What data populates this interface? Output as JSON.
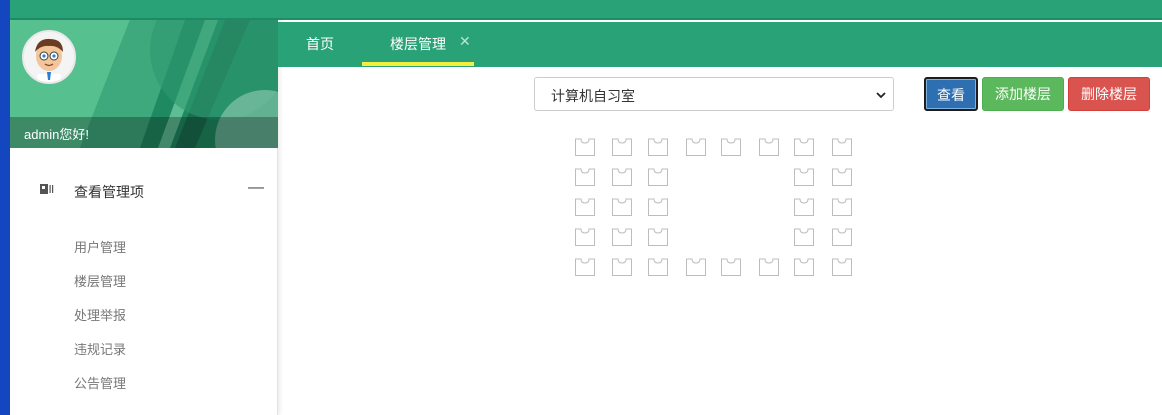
{
  "sidebar": {
    "welcome": "admin您好!",
    "group": {
      "label": "查看管理项",
      "icon": "id-card-icon",
      "collapse": "—"
    },
    "items": [
      {
        "label": "用户管理"
      },
      {
        "label": "楼层管理"
      },
      {
        "label": "处理举报"
      },
      {
        "label": "违规记录"
      },
      {
        "label": "公告管理"
      }
    ]
  },
  "tabs": [
    {
      "label": "首页",
      "active": false
    },
    {
      "label": "楼层管理",
      "active": true,
      "close": "✕"
    }
  ],
  "toolbar": {
    "room_select_value": "计算机自习室",
    "view_label": "查看",
    "add_label": "添加楼层",
    "delete_label": "删除楼层"
  },
  "seat_grid": {
    "icon": "seat-icon",
    "rows": [
      [
        1,
        1,
        1,
        1,
        1,
        1,
        1,
        1
      ],
      [
        1,
        1,
        1,
        0,
        0,
        0,
        1,
        1
      ],
      [
        1,
        1,
        1,
        0,
        0,
        0,
        1,
        1
      ],
      [
        1,
        1,
        1,
        0,
        0,
        0,
        1,
        1
      ],
      [
        1,
        1,
        1,
        1,
        1,
        1,
        1,
        1
      ]
    ]
  },
  "colors": {
    "brand_green": "#2aa278",
    "tab_active_underline": "#f4ee3f",
    "view_button": "#2d6fb1",
    "add_button": "#5cb85c",
    "delete_button": "#d9534f"
  }
}
